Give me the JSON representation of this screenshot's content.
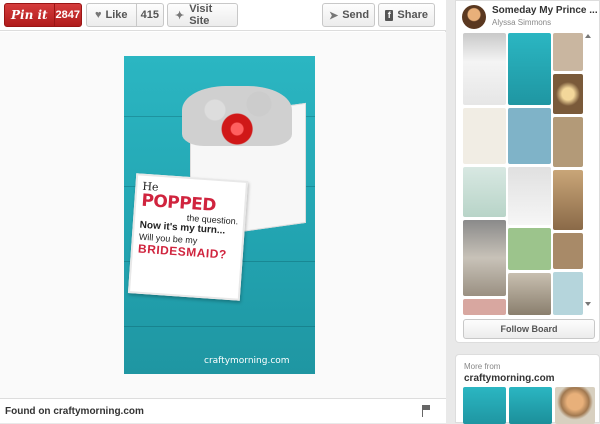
{
  "toolbar": {
    "pinit_label": "Pin it",
    "pinit_count": "2847",
    "like_label": "Like",
    "like_count": "415",
    "visit_label": "Visit Site",
    "send_label": "Send",
    "share_label": "Share"
  },
  "icons": {
    "heart": "heart-icon",
    "visit": "globe-icon",
    "send": "send-plane-icon",
    "share": "facebook-icon",
    "flag": "flag-icon"
  },
  "pin_image": {
    "line1": "He",
    "line2": "POPPED",
    "line3": "the question.",
    "line4": "Now it's my turn...",
    "line5": "Will you be my",
    "line6": "BRIDESMAID?",
    "watermark": "craftymorning.com"
  },
  "footer": {
    "found_on": "Found on craftymorning.com"
  },
  "board": {
    "title": "Someday My Prince ...",
    "user": "Alyssa Simmons",
    "follow_label": "Follow Board"
  },
  "more_from": {
    "label": "More from",
    "source": "craftymorning.com"
  },
  "colors": {
    "pinit_red": "#cb2027",
    "turquoise": "#25a9b6",
    "card_red": "#d0243e"
  }
}
